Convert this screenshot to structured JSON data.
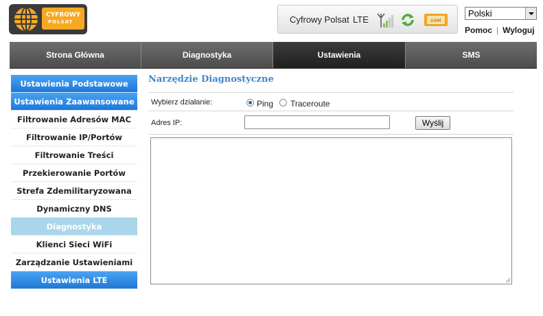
{
  "logo": {
    "line1": "CYFROWY",
    "line2": "POLSAT",
    "brand_color": "#f7a823"
  },
  "status": {
    "operator": "Cyfrowy Polsat",
    "network": "LTE",
    "signal_icon": "signal-antenna-icon",
    "sync_icon": "refresh-icon",
    "sim_icon": "usim-card-icon",
    "sim_label": "USIM"
  },
  "language": {
    "selected": "Polski"
  },
  "links": {
    "help": "Pomoc",
    "logout": "Wyloguj"
  },
  "nav": {
    "tabs": [
      {
        "label": "Strona Główna"
      },
      {
        "label": "Diagnostyka"
      },
      {
        "label": "Ustawienia",
        "active": true
      },
      {
        "label": "SMS"
      }
    ]
  },
  "sidebar": {
    "items": [
      {
        "label": "Ustawienia Podstawowe",
        "style": "blue"
      },
      {
        "label": "Ustawienia Zaawansowane",
        "style": "blue"
      },
      {
        "label": "Filtrowanie Adresów MAC"
      },
      {
        "label": "Filtrowanie IP/Portów"
      },
      {
        "label": "Filtrowanie Treści"
      },
      {
        "label": "Przekierowanie Portów"
      },
      {
        "label": "Strefa Zdemilitaryzowana"
      },
      {
        "label": "Dynamiczny DNS"
      },
      {
        "label": "Diagnostyka",
        "style": "current"
      },
      {
        "label": "Klienci Sieci WiFi"
      },
      {
        "label": "Zarządzanie Ustawieniami"
      },
      {
        "label": "Ustawienia LTE",
        "style": "blue"
      }
    ]
  },
  "main": {
    "title": "Narzędzie Diagnostyczne",
    "action_label": "Wybierz działanie:",
    "options": [
      {
        "label": "Ping",
        "checked": true
      },
      {
        "label": "Traceroute",
        "checked": false
      }
    ],
    "ip_label": "Adres IP:",
    "ip_value": "",
    "send_label": "Wyślij",
    "output_value": ""
  },
  "colors": {
    "accent": "#3f86c8",
    "sidebar_blue": "#2a86e0",
    "current_item": "#a9d6ea"
  }
}
